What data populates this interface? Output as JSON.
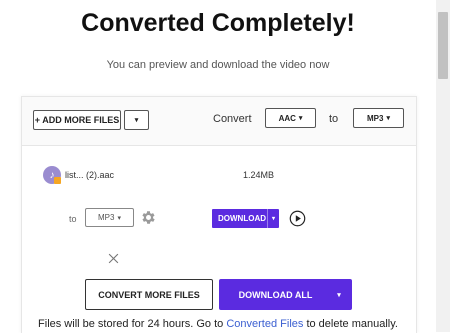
{
  "header": {
    "title": "Converted Completely!",
    "subtitle": "You can preview and download the video now"
  },
  "toolbar": {
    "add_more_label": "+ ADD MORE FILES",
    "add_more_caret": "▾",
    "convert_label": "Convert",
    "from_format": "AAC",
    "to_label": "to",
    "to_format": "MP3"
  },
  "file": {
    "name": "list... (2).aac",
    "size": "1.24MB",
    "to_label": "to",
    "output_format": "MP3",
    "download_label": "DOWNLOAD",
    "download_caret": "▾"
  },
  "actions": {
    "convert_more_label": "CONVERT MORE FILES",
    "download_all_label": "DOWNLOAD ALL",
    "download_all_caret": "▾"
  },
  "footer": {
    "note_before": "Files will be stored for 24 hours. Go to ",
    "note_link": "Converted Files",
    "note_after": " to delete manually."
  },
  "colors": {
    "accent": "#5b2be0",
    "link": "#3b5fd1"
  }
}
